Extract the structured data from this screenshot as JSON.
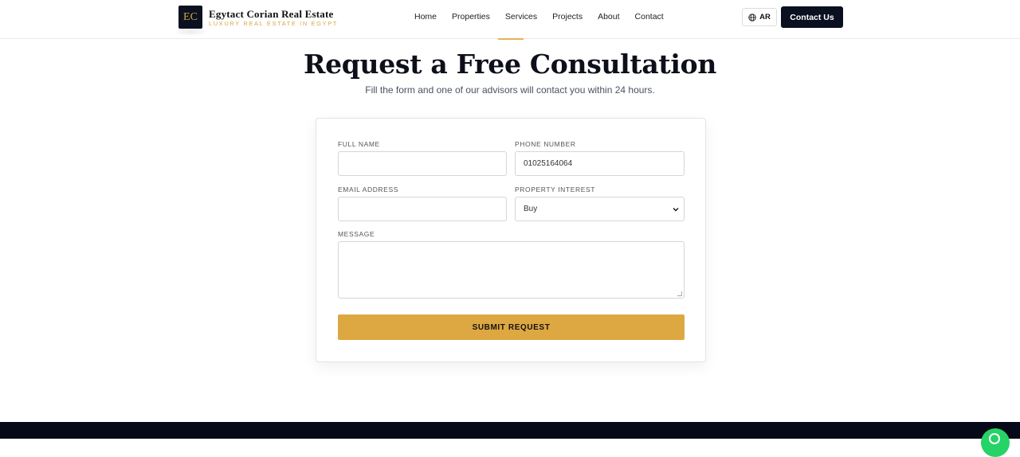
{
  "brand": {
    "logo_text": "EC",
    "name": "Egytact Corian Real Estate",
    "tagline": "LUXURY REAL ESTATE IN EGYPT",
    "accent_color": "#d9a843",
    "dark_color": "#0b1020"
  },
  "nav": {
    "items": [
      {
        "label": "Home"
      },
      {
        "label": "Properties"
      },
      {
        "label": "Services"
      },
      {
        "label": "Projects"
      },
      {
        "label": "About"
      },
      {
        "label": "Contact"
      }
    ]
  },
  "header_actions": {
    "lang_icon": "globe-icon",
    "lang_label": "AR",
    "contact_label": "Contact Us"
  },
  "hero": {
    "title": "Request a Free Consultation",
    "subtitle": "Fill the form and one of our advisors will contact you within 24 hours."
  },
  "form": {
    "full_name": {
      "label": "FULL NAME",
      "value": ""
    },
    "phone": {
      "label": "PHONE NUMBER",
      "value": "01025164064"
    },
    "email": {
      "label": "EMAIL ADDRESS",
      "value": ""
    },
    "interest": {
      "label": "PROPERTY INTEREST",
      "value": "Buy"
    },
    "message": {
      "label": "MESSAGE",
      "value": ""
    },
    "submit_label": "SUBMIT REQUEST",
    "submit_color": "#dda741"
  },
  "floating": {
    "icon": "whatsapp-icon",
    "color": "#25d366"
  }
}
